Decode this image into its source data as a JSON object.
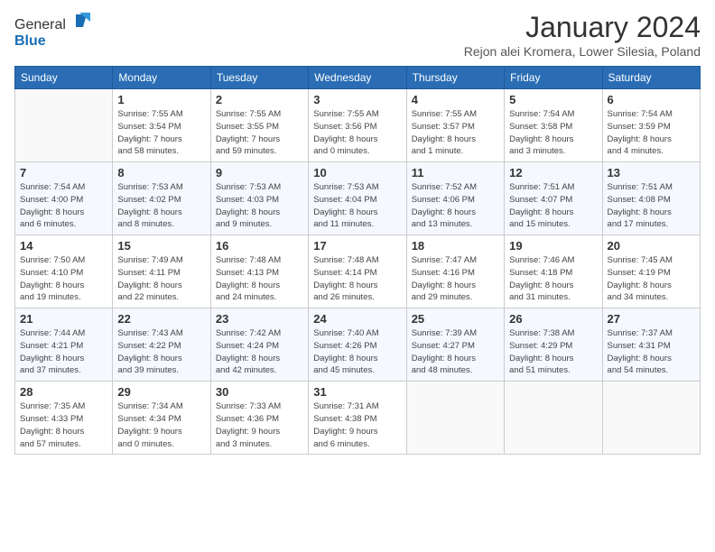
{
  "logo": {
    "general": "General",
    "blue": "Blue"
  },
  "title": "January 2024",
  "subtitle": "Rejon alei Kromera, Lower Silesia, Poland",
  "days_of_week": [
    "Sunday",
    "Monday",
    "Tuesday",
    "Wednesday",
    "Thursday",
    "Friday",
    "Saturday"
  ],
  "weeks": [
    [
      {
        "day": "",
        "info": ""
      },
      {
        "day": "1",
        "info": "Sunrise: 7:55 AM\nSunset: 3:54 PM\nDaylight: 7 hours\nand 58 minutes."
      },
      {
        "day": "2",
        "info": "Sunrise: 7:55 AM\nSunset: 3:55 PM\nDaylight: 7 hours\nand 59 minutes."
      },
      {
        "day": "3",
        "info": "Sunrise: 7:55 AM\nSunset: 3:56 PM\nDaylight: 8 hours\nand 0 minutes."
      },
      {
        "day": "4",
        "info": "Sunrise: 7:55 AM\nSunset: 3:57 PM\nDaylight: 8 hours\nand 1 minute."
      },
      {
        "day": "5",
        "info": "Sunrise: 7:54 AM\nSunset: 3:58 PM\nDaylight: 8 hours\nand 3 minutes."
      },
      {
        "day": "6",
        "info": "Sunrise: 7:54 AM\nSunset: 3:59 PM\nDaylight: 8 hours\nand 4 minutes."
      }
    ],
    [
      {
        "day": "7",
        "info": "Sunrise: 7:54 AM\nSunset: 4:00 PM\nDaylight: 8 hours\nand 6 minutes."
      },
      {
        "day": "8",
        "info": "Sunrise: 7:53 AM\nSunset: 4:02 PM\nDaylight: 8 hours\nand 8 minutes."
      },
      {
        "day": "9",
        "info": "Sunrise: 7:53 AM\nSunset: 4:03 PM\nDaylight: 8 hours\nand 9 minutes."
      },
      {
        "day": "10",
        "info": "Sunrise: 7:53 AM\nSunset: 4:04 PM\nDaylight: 8 hours\nand 11 minutes."
      },
      {
        "day": "11",
        "info": "Sunrise: 7:52 AM\nSunset: 4:06 PM\nDaylight: 8 hours\nand 13 minutes."
      },
      {
        "day": "12",
        "info": "Sunrise: 7:51 AM\nSunset: 4:07 PM\nDaylight: 8 hours\nand 15 minutes."
      },
      {
        "day": "13",
        "info": "Sunrise: 7:51 AM\nSunset: 4:08 PM\nDaylight: 8 hours\nand 17 minutes."
      }
    ],
    [
      {
        "day": "14",
        "info": "Sunrise: 7:50 AM\nSunset: 4:10 PM\nDaylight: 8 hours\nand 19 minutes."
      },
      {
        "day": "15",
        "info": "Sunrise: 7:49 AM\nSunset: 4:11 PM\nDaylight: 8 hours\nand 22 minutes."
      },
      {
        "day": "16",
        "info": "Sunrise: 7:48 AM\nSunset: 4:13 PM\nDaylight: 8 hours\nand 24 minutes."
      },
      {
        "day": "17",
        "info": "Sunrise: 7:48 AM\nSunset: 4:14 PM\nDaylight: 8 hours\nand 26 minutes."
      },
      {
        "day": "18",
        "info": "Sunrise: 7:47 AM\nSunset: 4:16 PM\nDaylight: 8 hours\nand 29 minutes."
      },
      {
        "day": "19",
        "info": "Sunrise: 7:46 AM\nSunset: 4:18 PM\nDaylight: 8 hours\nand 31 minutes."
      },
      {
        "day": "20",
        "info": "Sunrise: 7:45 AM\nSunset: 4:19 PM\nDaylight: 8 hours\nand 34 minutes."
      }
    ],
    [
      {
        "day": "21",
        "info": "Sunrise: 7:44 AM\nSunset: 4:21 PM\nDaylight: 8 hours\nand 37 minutes."
      },
      {
        "day": "22",
        "info": "Sunrise: 7:43 AM\nSunset: 4:22 PM\nDaylight: 8 hours\nand 39 minutes."
      },
      {
        "day": "23",
        "info": "Sunrise: 7:42 AM\nSunset: 4:24 PM\nDaylight: 8 hours\nand 42 minutes."
      },
      {
        "day": "24",
        "info": "Sunrise: 7:40 AM\nSunset: 4:26 PM\nDaylight: 8 hours\nand 45 minutes."
      },
      {
        "day": "25",
        "info": "Sunrise: 7:39 AM\nSunset: 4:27 PM\nDaylight: 8 hours\nand 48 minutes."
      },
      {
        "day": "26",
        "info": "Sunrise: 7:38 AM\nSunset: 4:29 PM\nDaylight: 8 hours\nand 51 minutes."
      },
      {
        "day": "27",
        "info": "Sunrise: 7:37 AM\nSunset: 4:31 PM\nDaylight: 8 hours\nand 54 minutes."
      }
    ],
    [
      {
        "day": "28",
        "info": "Sunrise: 7:35 AM\nSunset: 4:33 PM\nDaylight: 8 hours\nand 57 minutes."
      },
      {
        "day": "29",
        "info": "Sunrise: 7:34 AM\nSunset: 4:34 PM\nDaylight: 9 hours\nand 0 minutes."
      },
      {
        "day": "30",
        "info": "Sunrise: 7:33 AM\nSunset: 4:36 PM\nDaylight: 9 hours\nand 3 minutes."
      },
      {
        "day": "31",
        "info": "Sunrise: 7:31 AM\nSunset: 4:38 PM\nDaylight: 9 hours\nand 6 minutes."
      },
      {
        "day": "",
        "info": ""
      },
      {
        "day": "",
        "info": ""
      },
      {
        "day": "",
        "info": ""
      }
    ]
  ]
}
